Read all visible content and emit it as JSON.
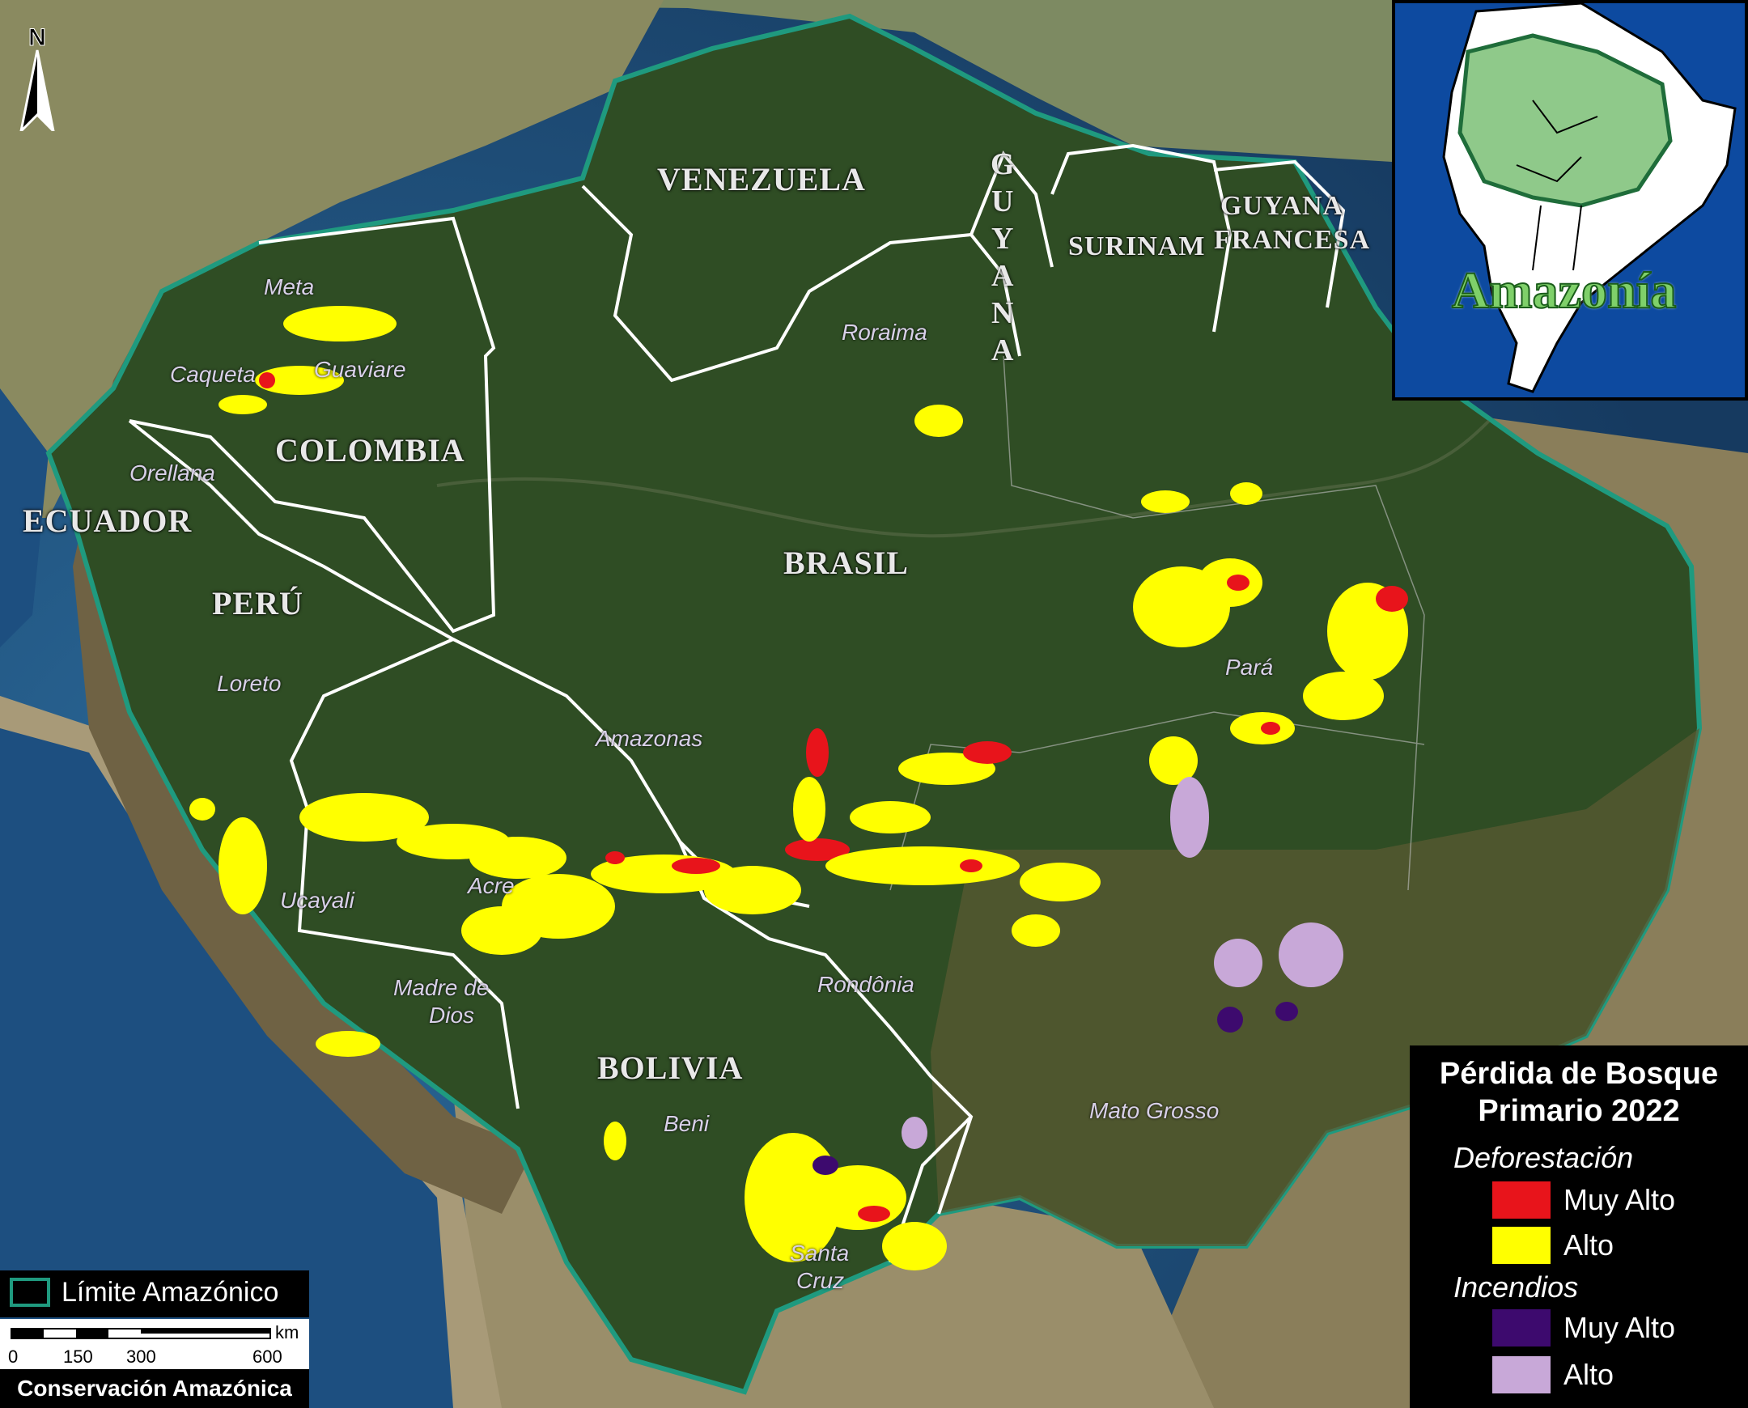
{
  "map": {
    "countries": [
      "VENEZUELA",
      "COLOMBIA",
      "ECUADOR",
      "PERÚ",
      "BRASIL",
      "BOLIVIA",
      "SURINAM",
      "GUYANA",
      "FRANCESA"
    ],
    "guyana_letters": [
      "G",
      "U",
      "Y",
      "A",
      "N",
      "A"
    ],
    "guyana_francesa_line1": "GUYANA",
    "regions": {
      "meta": "Meta",
      "caqueta": "Caqueta",
      "guaviare": "Guaviare",
      "orellana": "Orellana",
      "loreto": "Loreto",
      "ucayali": "Ucayali",
      "madre_de_dios_1": "Madre de",
      "madre_de_dios_2": "Dios",
      "acre": "Acre",
      "amazonas": "Amazonas",
      "roraima": "Roraima",
      "para": "Pará",
      "rondonia": "Rondônia",
      "mato_grosso": "Mato Grosso",
      "beni": "Beni",
      "santa_cruz_1": "Santa",
      "santa_cruz_2": "Cruz"
    },
    "north_label": "N"
  },
  "inset": {
    "title": "Amazonía"
  },
  "legend": {
    "title_line1": "Pérdida de Bosque",
    "title_line2": "Primario 2022",
    "deforestation_heading": "Deforestación",
    "fire_heading": "Incendios",
    "items": [
      {
        "label": "Muy Alto",
        "color": "#e8141b"
      },
      {
        "label": "Alto",
        "color": "#ffff00"
      },
      {
        "label": "Muy Alto",
        "color": "#3d0a6e"
      },
      {
        "label": "Alto",
        "color": "#c8a8d8"
      }
    ]
  },
  "limit_legend": {
    "label": "Límite Amazónico",
    "color": "#1f9a7f"
  },
  "scale": {
    "unit": "km",
    "ticks": [
      "0",
      "150",
      "300",
      "600"
    ]
  },
  "credit": "Conservación Amazónica",
  "colors": {
    "forest": "#2d4a22",
    "ocean": "#1b4a78",
    "andes": "#7a6a4a",
    "boundary": "#ffffff",
    "amazon_limit": "#1f9a7f"
  }
}
